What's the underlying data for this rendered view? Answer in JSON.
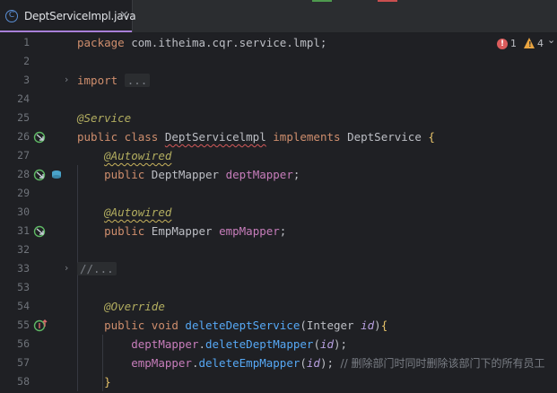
{
  "tab": {
    "filename": "DeptServiceImpl.java",
    "close": "✕",
    "icon_letter": "C"
  },
  "inspections": {
    "errors": "1",
    "warnings": "4",
    "error_icon": "error-icon",
    "warning_icon": "warning-icon",
    "chevron": "⌄"
  },
  "lines": [
    {
      "num": "1",
      "tokens": [
        [
          "kw",
          "package "
        ],
        [
          "pl",
          "com.itheima.cqr.service.lmpl;"
        ]
      ]
    },
    {
      "num": "2",
      "tokens": []
    },
    {
      "num": "3",
      "tokens": [
        [
          "kw",
          "import "
        ],
        [
          "fold",
          "..."
        ]
      ]
    },
    {
      "num": "24",
      "tokens": []
    },
    {
      "num": "25",
      "tokens": [
        [
          "ann",
          "@Service"
        ]
      ]
    },
    {
      "num": "26",
      "tokens": [
        [
          "kw",
          "public class "
        ],
        [
          "wavy",
          "DeptServicelmpl"
        ],
        [
          "pl",
          " "
        ],
        [
          "kw",
          "implements "
        ],
        [
          "pl",
          "DeptService "
        ],
        [
          "br",
          "{"
        ]
      ]
    },
    {
      "num": "27",
      "tokens": [
        [
          "pl",
          "    "
        ],
        [
          "annw",
          "@Autowired"
        ]
      ]
    },
    {
      "num": "28",
      "tokens": [
        [
          "pl",
          "    "
        ],
        [
          "kw",
          "public "
        ],
        [
          "pl",
          "DeptMapper "
        ],
        [
          "fld",
          "deptMapper"
        ],
        [
          "pl",
          ";"
        ]
      ]
    },
    {
      "num": "29",
      "tokens": []
    },
    {
      "num": "30",
      "tokens": [
        [
          "pl",
          "    "
        ],
        [
          "annw",
          "@Autowired"
        ]
      ]
    },
    {
      "num": "31",
      "tokens": [
        [
          "pl",
          "    "
        ],
        [
          "kw",
          "public "
        ],
        [
          "pl",
          "EmpMapper "
        ],
        [
          "fld",
          "empMapper"
        ],
        [
          "pl",
          ";"
        ]
      ]
    },
    {
      "num": "32",
      "tokens": []
    },
    {
      "num": "33",
      "tokens": [
        [
          "fold",
          "//..."
        ]
      ]
    },
    {
      "num": "53",
      "tokens": []
    },
    {
      "num": "54",
      "tokens": [
        [
          "pl",
          "    "
        ],
        [
          "ann",
          "@Override"
        ]
      ]
    },
    {
      "num": "55",
      "tokens": [
        [
          "pl",
          "    "
        ],
        [
          "kw",
          "public void "
        ],
        [
          "mth",
          "deleteDeptService"
        ],
        [
          "pl",
          "(Integer "
        ],
        [
          "prm",
          "id"
        ],
        [
          "pl",
          ")"
        ],
        [
          "br",
          "{"
        ]
      ]
    },
    {
      "num": "56",
      "tokens": [
        [
          "pl",
          "        "
        ],
        [
          "fld",
          "deptMapper"
        ],
        [
          "pl",
          "."
        ],
        [
          "mth",
          "deleteDeptMapper"
        ],
        [
          "pl",
          "("
        ],
        [
          "prm",
          "id"
        ],
        [
          "pl",
          ");"
        ]
      ]
    },
    {
      "num": "57",
      "tokens": [
        [
          "pl",
          "        "
        ],
        [
          "fld",
          "empMapper"
        ],
        [
          "pl",
          "."
        ],
        [
          "mth",
          "deleteEmpMapper"
        ],
        [
          "pl",
          "("
        ],
        [
          "prm",
          "id"
        ],
        [
          "pl",
          "); "
        ],
        [
          "cmt",
          "// 删除部门时同时删除该部门下的所有员工"
        ]
      ]
    },
    {
      "num": "58",
      "tokens": [
        [
          "pl",
          "    "
        ],
        [
          "br",
          "}"
        ]
      ]
    }
  ],
  "gutter_icons": {
    "3": "fold-expand-icon",
    "26": "implementation-icon",
    "28": "bean-injection-icon",
    "31": "bean-injection-icon",
    "33": "fold-expand-icon",
    "55": "override-method-icon"
  },
  "colors": {
    "background": "#1f2024",
    "keyword": "#cf8e6d",
    "annotation": "#b3ae60",
    "field": "#c77dbb",
    "method": "#56a8f5",
    "accent": "#a87fd8"
  }
}
